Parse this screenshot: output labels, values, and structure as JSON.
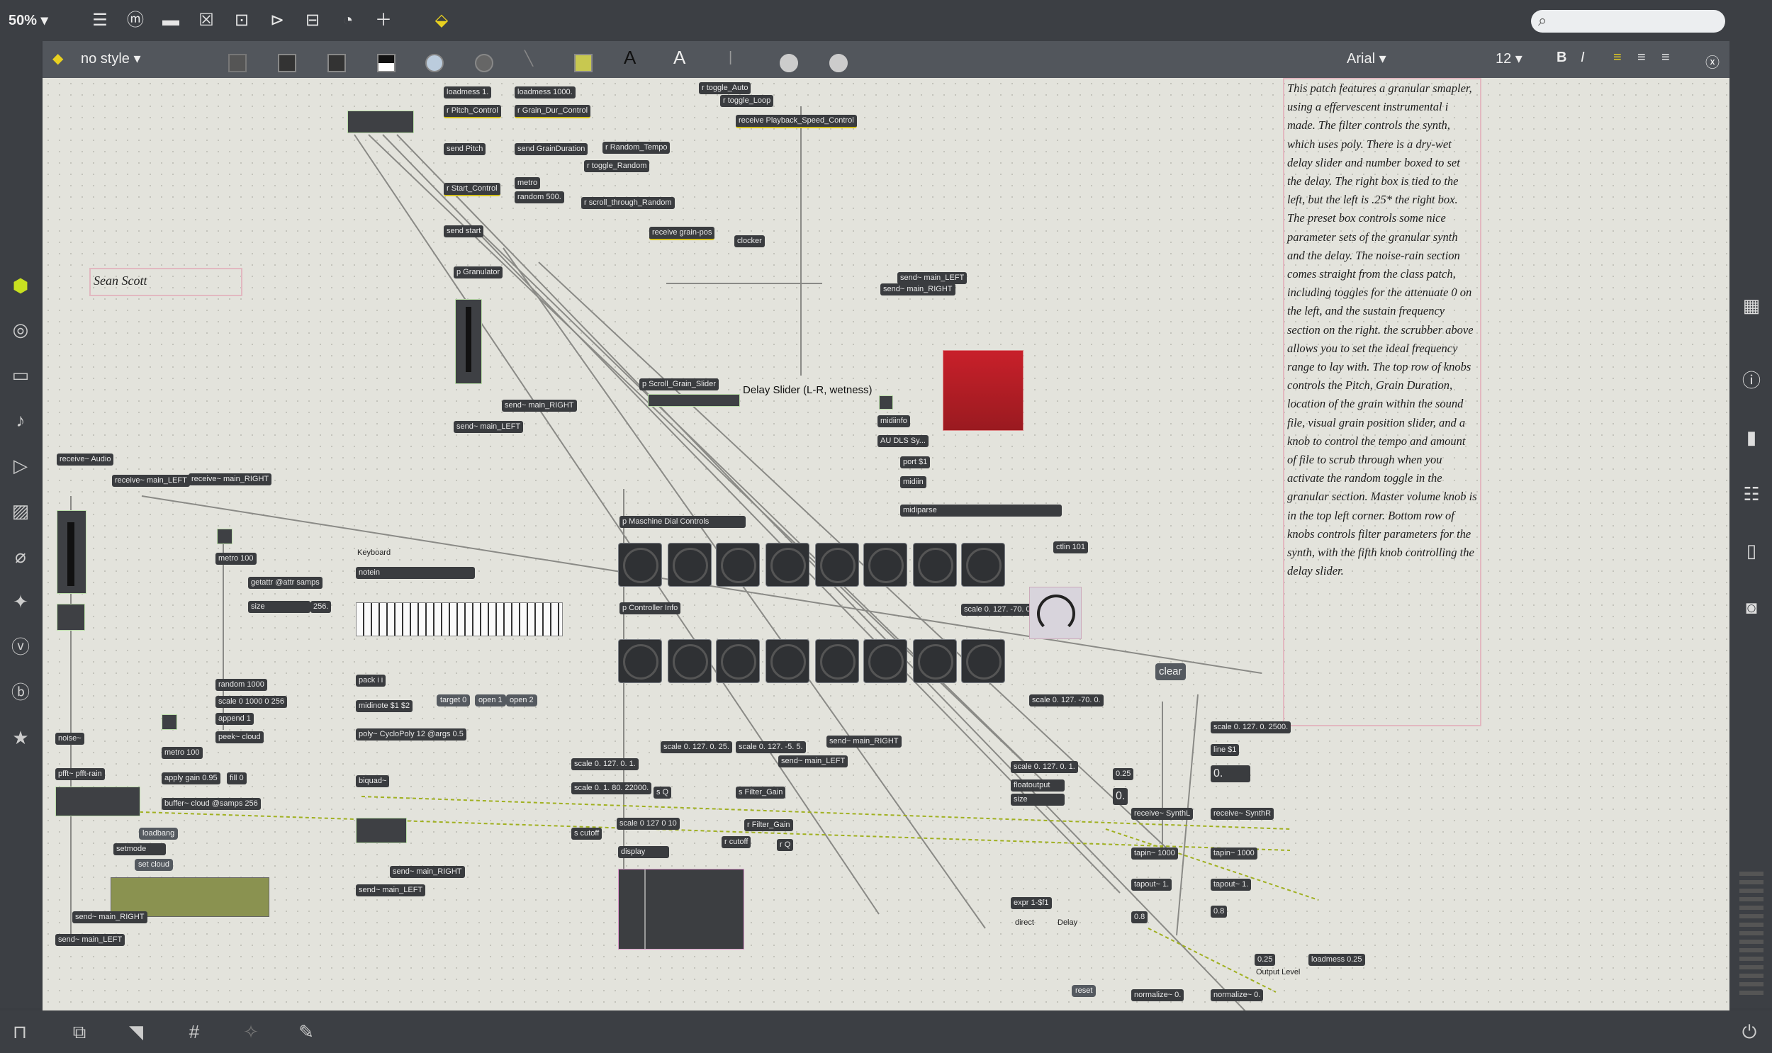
{
  "toolbar": {
    "zoom": "50%"
  },
  "stylebar": {
    "style_name": "no style",
    "font_name": "Arial",
    "font_size": "12",
    "bold": "B",
    "italic": "I",
    "text_a": "A"
  },
  "canvas": {
    "author": "Sean Scott",
    "delay_label": "Delay Slider (L-R, wetness)",
    "clear_label": "clear",
    "description": "This patch features a granular smapler, using a effervescent instrumental i made. The filter controls the synth, which uses poly. There is a dry-wet delay slider and number boxed to set the delay. The right box is tied to the left, but the left is .25* the right box. The preset box controls some nice parameter sets of the granular synth and the delay. The noise-rain section comes straight from the class patch, including toggles for the attenuate 0 on the left, and the sustain frequency section on the right. the scrubber above allows you to set the ideal frequency range to lay with. The top row of knobs controls the Pitch, Grain Duration, location of the grain within the sound file, visual grain position slider, and a knob to control the tempo and amount of file to scrub through when you activate the random toggle in the granular section. Master volume knob is in the top left corner. Bottom row of knobs controls filter parameters for the synth, with the fifth knob controlling the delay slider."
  },
  "objects": {
    "loadmess1": "loadmess 1.",
    "loadmess1000": "loadmess 1000.",
    "r_pitch": "r Pitch_Control",
    "r_graindur": "r Grain_Dur_Control",
    "send_pitch": "send Pitch",
    "send_graindur": "send GrainDuration",
    "r_random_tempo": "r Random_Tempo",
    "r_toggle_random": "r toggle_Random",
    "r_start": "r Start_Control",
    "metro": "metro",
    "random500": "random 500.",
    "r_scroll": "r scroll_through_Random",
    "send_start": "send start",
    "p_granulator": "p Granulator",
    "send_main_right1": "send~ main_RIGHT",
    "send_main_left1": "send~ main_LEFT",
    "r_toggle_auto": "r toggle_Auto",
    "r_toggle_loop": "r toggle_Loop",
    "receive_playback": "receive Playback_Speed_Control",
    "receive_grainpos": "receive grain-pos",
    "clocker": "clocker",
    "send_main_left_top": "send~ main_LEFT",
    "send_main_right_top": "send~ main_RIGHT",
    "p_scroll_grain": "p Scroll_Grain_Slider",
    "midiinfo": "midiinfo",
    "au_dls": "AU DLS Sy...",
    "port": "port $1",
    "midiin": "midiin",
    "midiparse": "midiparse",
    "receive_audio": "receive~ Audio",
    "receive_main_left": "receive~ main_LEFT",
    "receive_main_right": "receive~ main_RIGHT",
    "metro100": "metro 100",
    "getattr": "getattr @attr samps",
    "size": "size",
    "size_val": "256.",
    "random1000": "random 1000",
    "scale_1000": "scale 0 1000 0 256",
    "append1": "append 1",
    "peek_cloud": "peek~ cloud",
    "keyboard": "Keyboard",
    "notein": "notein",
    "pack": "pack i i",
    "midinote": "midinote $1 $2",
    "target0": "target 0",
    "open1": "open 1",
    "open2": "open 2",
    "poly": "poly~ CycloPoly 12 @args 0.5",
    "biquad": "biquad~",
    "send_main_right2": "send~ main_RIGHT",
    "send_main_left2": "send~ main_LEFT",
    "p_maschine": "p Maschine Dial Controls",
    "p_controller": "p Controller Info",
    "ctlin": "ctlin 101",
    "scale_127_70": "scale 0. 127. -70. 0.",
    "scale_127_70b": "scale 0. 127. -70. 0.",
    "noise": "noise~",
    "pfft": "pfft~ pfft-rain",
    "metro100b": "metro 100",
    "apply_gain": "apply gain 0.95",
    "fill0": "fill 0",
    "buffer_cloud": "buffer~ cloud @samps 256",
    "loadbang": "loadbang",
    "setmode": "setmode",
    "set_cloud": "set cloud",
    "send_main_right3": "send~ main_RIGHT",
    "send_main_left3": "send~ main_LEFT",
    "scale_a": "scale 0. 127. 0. 1.",
    "scale_b": "scale 0. 127. 0. 25.",
    "scale_c": "scale 0. 127. -5. 5.",
    "scale_d": "scale 0. 1. 80. 22000.",
    "send_main_right4": "send~ main_RIGHT",
    "send_main_left4": "send~ main_LEFT",
    "s_q": "s Q",
    "s_filter_gain": "s Filter_Gain",
    "s_cutoff": "s cutoff",
    "r_filter_gain": "r Filter_Gain",
    "scale_127_10": "scale 0 127 0 10",
    "r_cutoff": "r cutoff",
    "r_q": "r Q",
    "display": "display",
    "scale_127_1": "scale 0. 127. 0. 1.",
    "scale_2500": "scale 0. 127. 0. 2500.",
    "floatoutput": "floatoutput",
    "size2": "size",
    "line1": "line $1",
    "receive_synthl": "receive~ SynthL",
    "receive_synthr": "receive~ SynthR",
    "tapin1": "tapin~ 1000",
    "tapin2": "tapin~ 1000",
    "tapout1": "tapout~ 1.",
    "tapout2": "tapout~ 1.",
    "expr": "expr 1-$f1",
    "direct": "direct",
    "delay": "Delay",
    "reset": "reset",
    "normalize1": "normalize~ 0.",
    "normalize2": "normalize~ 0.",
    "loadmess025": "loadmess 0.25",
    "output_level": "Output Level",
    "num_025": "0.25",
    "num_0": "0.",
    "num_08": "0.8"
  }
}
